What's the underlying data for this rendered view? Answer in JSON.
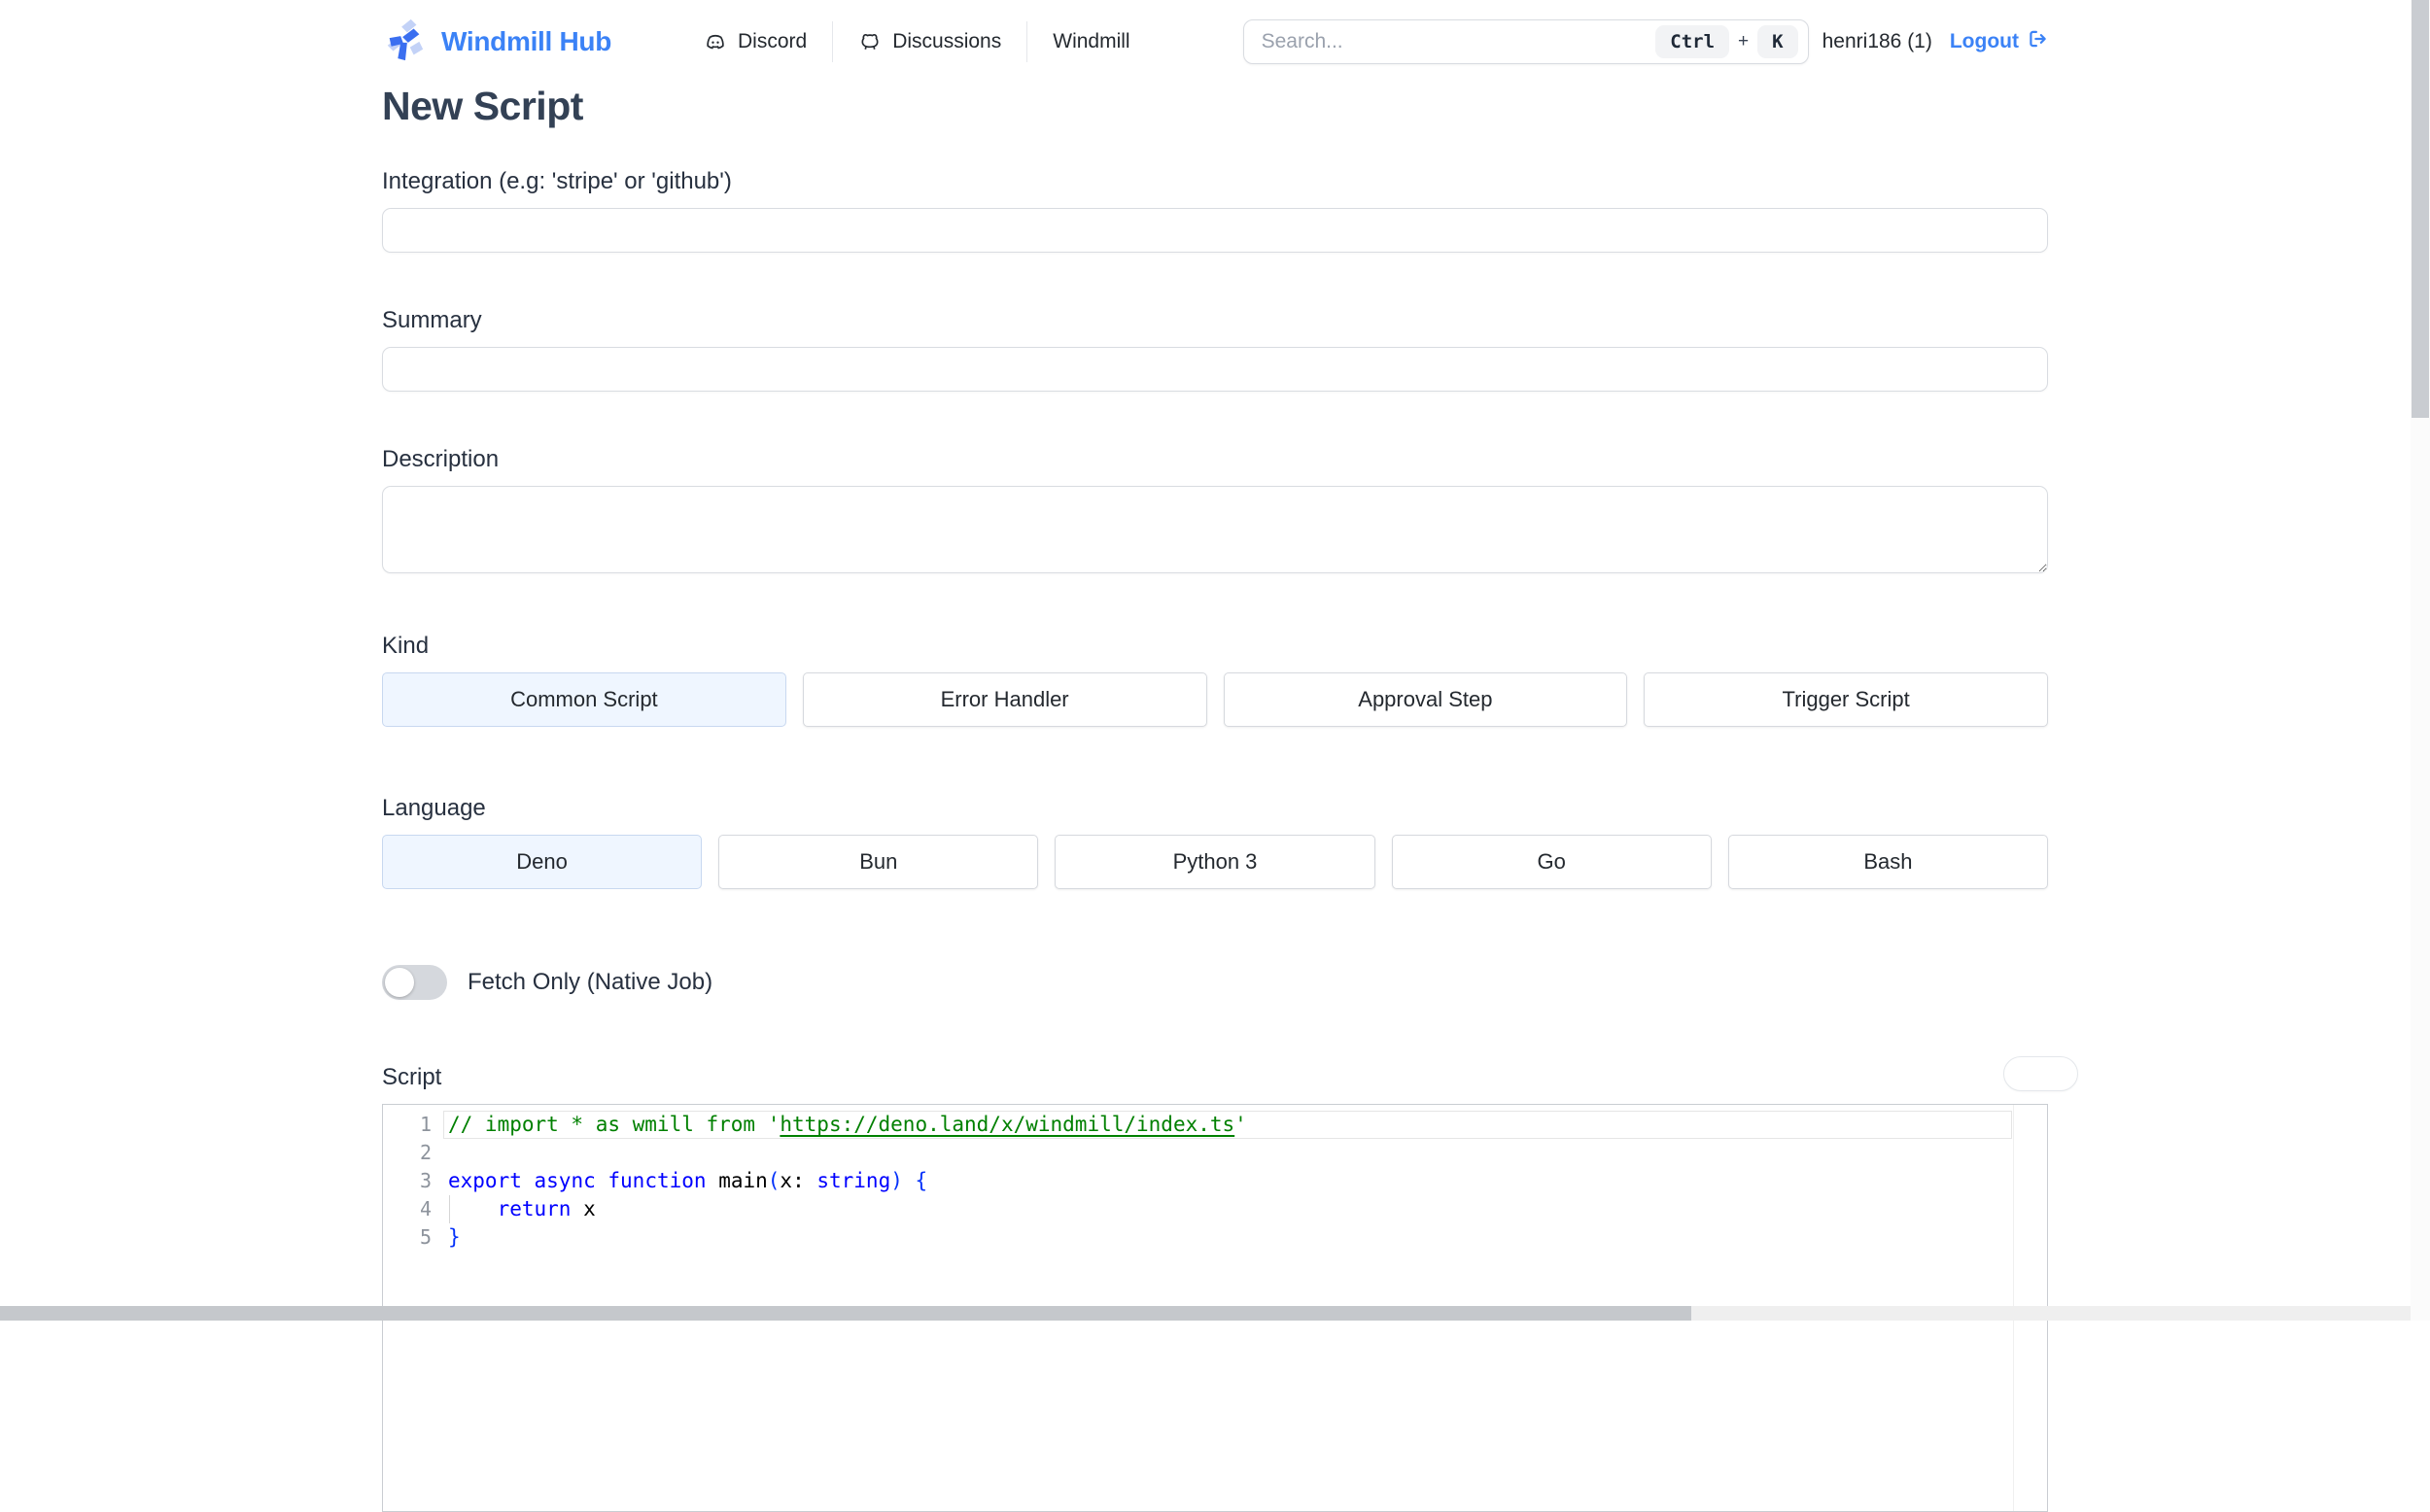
{
  "header": {
    "brand": "Windmill Hub",
    "nav": [
      {
        "label": "Discord",
        "icon": "discord-icon"
      },
      {
        "label": "Discussions",
        "icon": "github-discussions-icon"
      },
      {
        "label": "Windmill",
        "icon": ""
      }
    ],
    "search": {
      "placeholder": "Search...",
      "shortcut": {
        "key1": "Ctrl",
        "separator": "+",
        "key2": "K"
      }
    },
    "user": "henri186 (1)",
    "logout": "Logout"
  },
  "page": {
    "title": "New Script"
  },
  "form": {
    "integration_label": "Integration (e.g: 'stripe' or 'github')",
    "integration_value": "",
    "summary_label": "Summary",
    "summary_value": "",
    "description_label": "Description",
    "description_value": "",
    "kind_label": "Kind",
    "kind_options": [
      "Common Script",
      "Error Handler",
      "Approval Step",
      "Trigger Script"
    ],
    "kind_selected": "Common Script",
    "language_label": "Language",
    "language_options": [
      "Deno",
      "Bun",
      "Python 3",
      "Go",
      "Bash"
    ],
    "language_selected": "Deno",
    "fetch_only_label": "Fetch Only (Native Job)",
    "fetch_only_enabled": false,
    "script_label": "Script"
  },
  "editor": {
    "colors": {
      "comment": "#008000",
      "keyword": "#0000ff",
      "plain": "#000000",
      "bracket": "#0431fa",
      "line_number": "#8d939c"
    },
    "lines": [
      {
        "number": "1",
        "current": true,
        "tokens": [
          {
            "type": "comment",
            "text": "// import * as wmill from '"
          },
          {
            "type": "comment_link",
            "text": "https://deno.land/x/windmill/index.ts"
          },
          {
            "type": "comment",
            "text": "'"
          }
        ]
      },
      {
        "number": "2",
        "tokens": []
      },
      {
        "number": "3",
        "tokens": [
          {
            "type": "keyword",
            "text": "export"
          },
          {
            "type": "plain",
            "text": " "
          },
          {
            "type": "keyword",
            "text": "async"
          },
          {
            "type": "plain",
            "text": " "
          },
          {
            "type": "keyword",
            "text": "function"
          },
          {
            "type": "plain",
            "text": " main"
          },
          {
            "type": "bracket",
            "text": "("
          },
          {
            "type": "plain",
            "text": "x: "
          },
          {
            "type": "keyword",
            "text": "string"
          },
          {
            "type": "bracket",
            "text": ")"
          },
          {
            "type": "plain",
            "text": " "
          },
          {
            "type": "bracket",
            "text": "{"
          }
        ]
      },
      {
        "number": "4",
        "indent_guide": true,
        "tokens": [
          {
            "type": "plain",
            "text": "    "
          },
          {
            "type": "keyword",
            "text": "return"
          },
          {
            "type": "plain",
            "text": " x"
          }
        ]
      },
      {
        "number": "5",
        "tokens": [
          {
            "type": "bracket",
            "text": "}"
          }
        ]
      }
    ]
  }
}
